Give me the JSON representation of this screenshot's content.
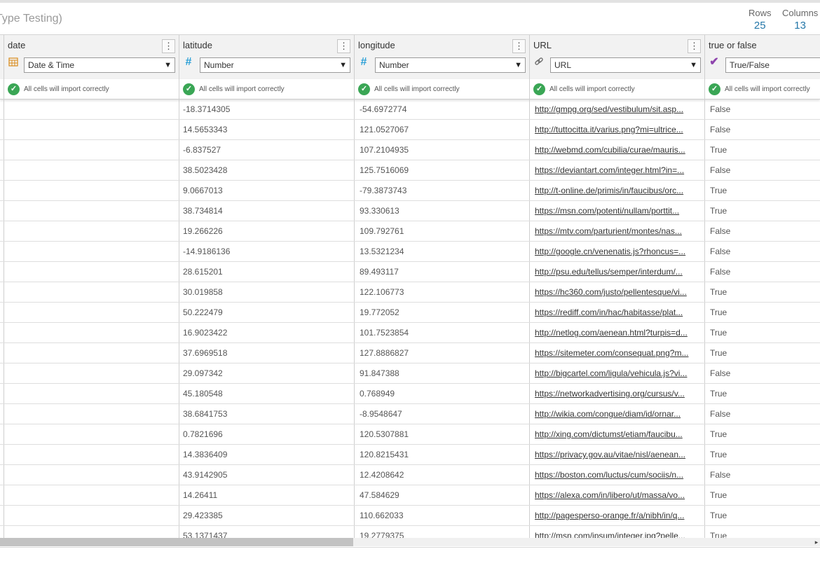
{
  "header": {
    "title": "Type Testing)",
    "rows_label": "Rows",
    "rows_value": "25",
    "columns_label": "Columns",
    "columns_value": "13"
  },
  "columns": [
    {
      "name": "date",
      "type": "Date & Time",
      "type_icon": "calendar-icon",
      "icon_color": "#d98b1c",
      "status": "All cells will import correctly"
    },
    {
      "name": "latitude",
      "type": "Number",
      "type_icon": "hash-icon",
      "icon_color": "#2a9fd6",
      "status": "All cells will import correctly"
    },
    {
      "name": "longitude",
      "type": "Number",
      "type_icon": "hash-icon",
      "icon_color": "#2a9fd6",
      "status": "All cells will import correctly"
    },
    {
      "name": "URL",
      "type": "URL",
      "type_icon": "link-icon",
      "icon_color": "#666666",
      "status": "All cells will import correctly"
    },
    {
      "name": "true or false",
      "type": "True/False",
      "type_icon": "checkmark-icon",
      "icon_color": "#8e44ad",
      "status": "All cells will import correctly"
    }
  ],
  "rows": [
    {
      "latitude": "-18.3714305",
      "longitude": "-54.6972774",
      "url": "http://gmpg.org/sed/vestibulum/sit.asp...",
      "bool": "False"
    },
    {
      "latitude": "14.5653343",
      "longitude": "121.0527067",
      "url": "http://tuttocitta.it/varius.png?mi=ultrice...",
      "bool": "False"
    },
    {
      "latitude": "-6.837527",
      "longitude": "107.2104935",
      "url": "http://webmd.com/cubilia/curae/mauris...",
      "bool": "True"
    },
    {
      "latitude": "38.5023428",
      "longitude": "125.7516069",
      "url": "https://deviantart.com/integer.html?in=...",
      "bool": "False"
    },
    {
      "latitude": "9.0667013",
      "longitude": "-79.3873743",
      "url": "http://t-online.de/primis/in/faucibus/orc...",
      "bool": "True"
    },
    {
      "latitude": "38.734814",
      "longitude": "93.330613",
      "url": "https://msn.com/potenti/nullam/porttit...",
      "bool": "True"
    },
    {
      "latitude": "19.266226",
      "longitude": "109.792761",
      "url": "https://mtv.com/parturient/montes/nas...",
      "bool": "False"
    },
    {
      "latitude": "-14.9186136",
      "longitude": "13.5321234",
      "url": "http://google.cn/venenatis.js?rhoncus=...",
      "bool": "False"
    },
    {
      "latitude": "28.615201",
      "longitude": "89.493117",
      "url": "http://psu.edu/tellus/semper/interdum/...",
      "bool": "False"
    },
    {
      "latitude": "30.019858",
      "longitude": "122.106773",
      "url": "https://hc360.com/justo/pellentesque/vi...",
      "bool": "True"
    },
    {
      "latitude": "50.222479",
      "longitude": "19.772052",
      "url": "https://rediff.com/in/hac/habitasse/plat...",
      "bool": "True"
    },
    {
      "latitude": "16.9023422",
      "longitude": "101.7523854",
      "url": "http://netlog.com/aenean.html?turpis=d...",
      "bool": "True"
    },
    {
      "latitude": "37.6969518",
      "longitude": "127.8886827",
      "url": "https://sitemeter.com/consequat.png?m...",
      "bool": "True"
    },
    {
      "latitude": "29.097342",
      "longitude": "91.847388",
      "url": "http://bigcartel.com/ligula/vehicula.js?vi...",
      "bool": "False"
    },
    {
      "latitude": "45.180548",
      "longitude": "0.768949",
      "url": "https://networkadvertising.org/cursus/v...",
      "bool": "True"
    },
    {
      "latitude": "38.6841753",
      "longitude": "-8.9548647",
      "url": "http://wikia.com/congue/diam/id/ornar...",
      "bool": "False"
    },
    {
      "latitude": "0.7821696",
      "longitude": "120.5307881",
      "url": "http://xing.com/dictumst/etiam/faucibu...",
      "bool": "True"
    },
    {
      "latitude": "14.3836409",
      "longitude": "120.8215431",
      "url": "https://privacy.gov.au/vitae/nisl/aenean...",
      "bool": "True"
    },
    {
      "latitude": "43.9142905",
      "longitude": "12.4208642",
      "url": "https://boston.com/luctus/cum/sociis/n...",
      "bool": "False"
    },
    {
      "latitude": "14.26411",
      "longitude": "47.584629",
      "url": "https://alexa.com/in/libero/ut/massa/vo...",
      "bool": "True"
    },
    {
      "latitude": "29.423385",
      "longitude": "110.662033",
      "url": "http://pagesperso-orange.fr/a/nibh/in/q...",
      "bool": "True"
    },
    {
      "latitude": "53.1371437",
      "longitude": "19.2779375",
      "url": "http://msn.com/ipsum/integer.jpg?pelle...",
      "bool": "True"
    }
  ]
}
